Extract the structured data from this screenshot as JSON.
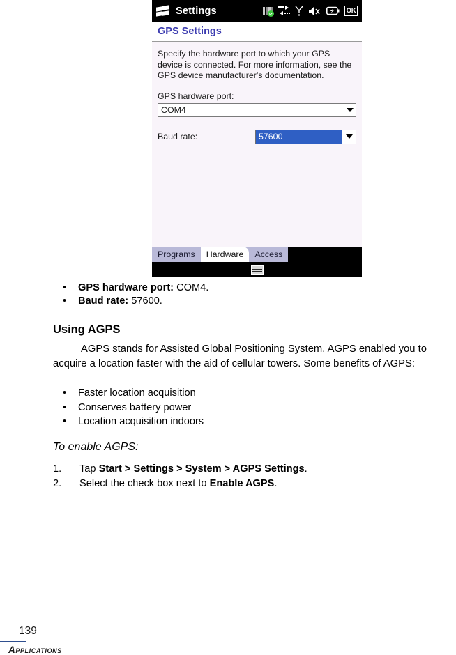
{
  "device": {
    "titlebar": {
      "start_icon": "windows-flag-icon",
      "title": "Settings",
      "icons": [
        {
          "name": "signal-bars-icon",
          "label": "signal"
        },
        {
          "name": "connectivity-arrows-icon",
          "label": "connectivity"
        },
        {
          "name": "antenna-icon",
          "label": "antenna"
        },
        {
          "name": "volume-mute-icon",
          "label": "mute"
        },
        {
          "name": "battery-icon",
          "label": "battery"
        }
      ],
      "ok_label": "OK"
    },
    "page_header": "GPS Settings",
    "description": "Specify the hardware port to which your GPS device is connected. For more information, see the GPS device manufacturer's documentation.",
    "port_label": "GPS hardware port:",
    "port_value": "COM4",
    "baud_label": "Baud rate:",
    "baud_value": "57600",
    "tabs": [
      {
        "label": "Programs",
        "active": false
      },
      {
        "label": "Hardware",
        "active": true
      },
      {
        "label": "Access",
        "active": false
      }
    ],
    "sip_icon": "keyboard-icon",
    "colors": {
      "header_text": "#3b3bb0",
      "panel_bg": "#f9f4fa",
      "tab_bg": "#b9b9d8",
      "selection_blue": "#2f5fc4"
    }
  },
  "settings_bullets": [
    {
      "bullet": "•",
      "label": "GPS hardware port:",
      "value": " COM4."
    },
    {
      "bullet": "•",
      "label": "Baud rate:",
      "value": " 57600."
    }
  ],
  "section": {
    "heading": "Using AGPS",
    "paragraph": "AGPS stands for Assisted Global Positioning System. AGPS enabled you to acquire a location faster with the aid of cellular towers. Some benefits of AGPS:",
    "benefits": [
      {
        "bullet": "•",
        "text": "Faster location acquisition"
      },
      {
        "bullet": "•",
        "text": "Conserves battery power"
      },
      {
        "bullet": "•",
        "text": "Location acquisition indoors"
      }
    ],
    "procedure_title": "To enable AGPS:",
    "steps": [
      {
        "num": "1.",
        "pre": "Tap ",
        "bold": "Start > Settings > System > AGPS Settings",
        "post": "."
      },
      {
        "num": "2.",
        "pre": "Select the check box next to ",
        "bold": "Enable AGPS",
        "post": "."
      }
    ]
  },
  "footer": {
    "page_number": "139",
    "label": "Applications",
    "rule_color": "#2f4f8f"
  }
}
